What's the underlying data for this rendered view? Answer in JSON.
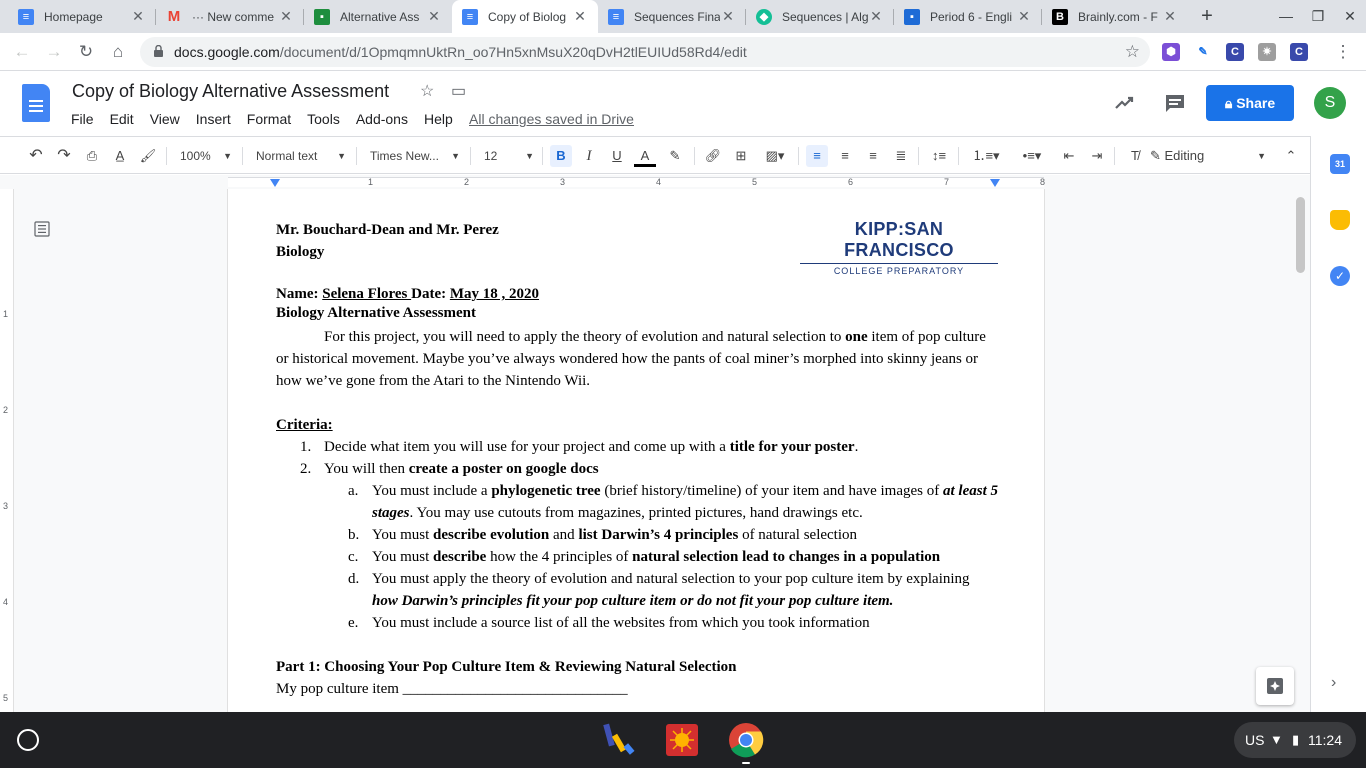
{
  "browser": {
    "tabs": [
      {
        "title": "Homepage",
        "icon": "docs-icon",
        "color": "#4285f4",
        "active": false
      },
      {
        "title": "··· New comme",
        "icon": "gmail-icon",
        "color": "#ea4335",
        "active": false
      },
      {
        "title": "Alternative Ass",
        "icon": "classroom-icon",
        "color": "#1e8e3e",
        "active": false
      },
      {
        "title": "Copy of Biolog",
        "icon": "docs-icon",
        "color": "#4285f4",
        "active": true
      },
      {
        "title": "Sequences Fina",
        "icon": "docs-icon",
        "color": "#4285f4",
        "active": false
      },
      {
        "title": "Sequences | Alg",
        "icon": "khan-icon",
        "color": "#14bf96",
        "active": false
      },
      {
        "title": "Period 6 - Engli",
        "icon": "classroom-icon",
        "color": "#1e6bd6",
        "active": false
      },
      {
        "title": "Brainly.com - F",
        "icon": "brainly-icon",
        "color": "#000000",
        "active": false
      }
    ],
    "url_host": "docs.google.com",
    "url_path": "/document/d/1OpmqmnUktRn_oo7Hn5xnMsuX20qDvH2tlEUIUd58Rd4/edit"
  },
  "docs": {
    "title": "Copy of Biology Alternative Assessment",
    "menu": [
      "File",
      "Edit",
      "View",
      "Insert",
      "Format",
      "Tools",
      "Add-ons",
      "Help"
    ],
    "saved_status": "All changes saved in Drive",
    "share_label": "Share",
    "avatar_letter": "S",
    "toolbar": {
      "zoom": "100%",
      "style": "Normal text",
      "font": "Times New...",
      "size": "12",
      "mode": "Editing"
    },
    "ruler_ticks": [
      "1",
      "2",
      "3",
      "4",
      "5",
      "6",
      "7",
      "8"
    ],
    "vruler_ticks": [
      "1",
      "2",
      "3",
      "4",
      "5"
    ]
  },
  "document": {
    "logo_main": "KIPP:SAN FRANCISCO",
    "logo_sub": "COLLEGE PREPARATORY",
    "teachers": "Mr. Bouchard-Dean and Mr. Perez",
    "subject": "Biology",
    "name_label": "Name:",
    "name_value": "Selena Flores ",
    "date_label": "Date:",
    "date_value": "May 18 , 2020",
    "assessment_title": "Biology Alternative Assessment",
    "intro_a": "For this project, you will need to apply the theory of evolution and natural selection to ",
    "intro_b": "one",
    "intro_c": " item of pop culture or historical movement. Maybe you’ve always wondered how the pants of coal miner’s morphed into skinny jeans or how we’ve gone from the Atari to the Nintendo Wii.",
    "criteria_heading": "Criteria:",
    "item1_a": "Decide what item you will use for your project and come up with a ",
    "item1_b": "title for your poster",
    "item1_c": ".",
    "item2_a": "You will then ",
    "item2_b": "create a poster on google docs",
    "sub_a_1": "You must include a ",
    "sub_a_2": "phylogenetic tree",
    "sub_a_3": " (brief history/timeline) of your item and have images of  ",
    "sub_a_4": "at least 5 stages",
    "sub_a_5": ". You may use cutouts from magazines, printed pictures, hand drawings etc.",
    "sub_b_1": "You must ",
    "sub_b_2": "describe evolution",
    "sub_b_3": " and ",
    "sub_b_4": "list Darwin’s 4 principles",
    "sub_b_5": " of natural selection",
    "sub_c_1": "You must ",
    "sub_c_2": "describe",
    "sub_c_3": " how the 4 principles of ",
    "sub_c_4": "natural selection lead to changes in a population",
    "sub_d_1": "You must apply the theory of evolution and natural selection to your pop culture item by explaining ",
    "sub_d_2": "how Darwin’s principles fit your pop culture item or do not fit your pop culture item.",
    "sub_e": "You must include a source list of all the websites from which you took information",
    "part1_heading": "Part 1: Choosing Your Pop Culture Item & Reviewing Natural Selection",
    "part1_line": "My pop culture item ______________________________"
  },
  "shelf": {
    "ime": "US",
    "time": "11:24"
  }
}
